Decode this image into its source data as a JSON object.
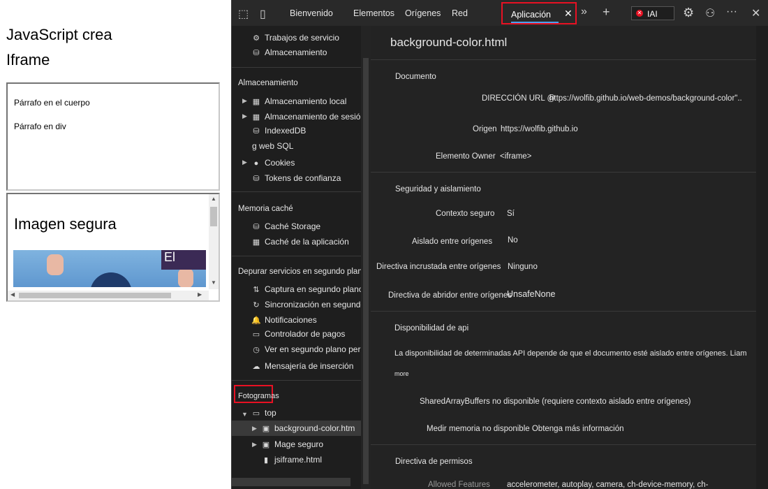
{
  "page": {
    "title_line1": "JavaScript crea",
    "title_line2": "Iframe",
    "frame1_p1": "Párrafo en el cuerpo",
    "frame1_p2": "Párrafo en div",
    "frame2_heading": "Imagen segura",
    "frame2_sign": "El"
  },
  "toolbar": {
    "tabs": [
      "Bienvenido",
      "Elementos",
      "Orígenes",
      "Red"
    ],
    "active_tab": "Aplicación",
    "close": "✕",
    "more_tabs": "»",
    "add_tab": "+",
    "error_badge": "IAI",
    "settings_icon": "⚙",
    "more_icon": "···",
    "close_icon": "✕"
  },
  "sidebar": {
    "top_items": [
      "Trabajos de servicio",
      "Almacenamiento"
    ],
    "storage_header": "Almacenamiento",
    "storage_items": [
      "Almacenamiento local",
      "Almacenamiento de sesión",
      "IndexedDB",
      "g web SQL",
      "Cookies",
      "Tokens de confianza"
    ],
    "cache_header": "Memoria caché",
    "cache_items": [
      "Caché Storage",
      "Caché de la aplicación"
    ],
    "bg_header": "Depurar servicios en segundo plano",
    "bg_items": [
      "Captura en segundo plano",
      "Sincronización en segundo plano",
      "Notificaciones",
      "Controlador de pagos",
      "Ver en segundo plano periódico",
      "Mensajería de inserción"
    ],
    "frames_header": "Fotogramas",
    "frames": [
      "top",
      "background-color.htm",
      "Mage seguro",
      "jsiframe.html"
    ]
  },
  "main": {
    "title": "background-color.html",
    "document_header": "Documento",
    "url_label": "DIRECCIÓN URL @",
    "url_value": "https://wolfib.github.io/web-demos/background-color\"..",
    "origin_label": "Origen",
    "origin_value": "https://wolfib.github.io",
    "owner_label": "Elemento Owner",
    "owner_value": "<iframe>",
    "security_header": "Seguridad y aislamiento",
    "secure_ctx_label": "Contexto seguro",
    "secure_ctx_value": "Sí",
    "cross_iso_label": "Aislado entre orígenes",
    "cross_iso_value": "No",
    "coep_label": "Directiva incrustada entre orígenes",
    "coep_value": "Ninguno",
    "coop_label": "Directiva de abridor entre orígenes",
    "coop_value": "UnsafeNone",
    "api_header": "Disponibilidad de api",
    "api_desc": "La disponibilidad de determinadas API depende de que el documento esté aislado entre orígenes. Liam",
    "api_more": "more",
    "sab_text": "SharedArrayBuffers no disponible (requiere contexto aislado entre orígenes)",
    "mem_text": "Medir memoria no disponible Obtenga más información",
    "perm_header": "Directiva de permisos",
    "allowed_label": "Allowed Features",
    "allowed_value": "accelerometer, autoplay, camera, ch-device-memory, ch-"
  }
}
